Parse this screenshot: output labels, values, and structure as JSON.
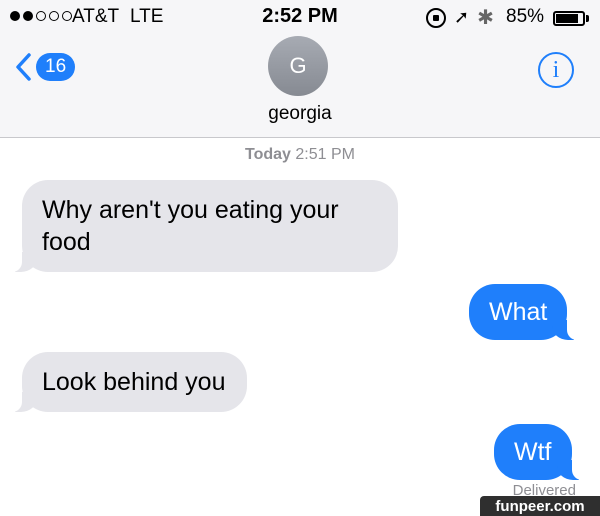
{
  "status_bar": {
    "carrier": "AT&T",
    "network": "LTE",
    "time": "2:52 PM",
    "battery_percent_text": "85%",
    "battery_level": 0.85,
    "signal_bars_filled": 2,
    "signal_bars_total": 5,
    "icons": [
      "orientation-lock-icon",
      "location-arrow-icon",
      "bluetooth-icon",
      "battery-icon"
    ]
  },
  "nav": {
    "back_badge": "16",
    "avatar_initial": "G",
    "contact_name": "georgia",
    "info_label": "i"
  },
  "conversation": {
    "timestamp_day": "Today",
    "timestamp_time": "2:51 PM",
    "messages": [
      {
        "direction": "incoming",
        "text": "Why aren't you eating your food"
      },
      {
        "direction": "outgoing",
        "text": "What"
      },
      {
        "direction": "incoming",
        "text": "Look behind you"
      },
      {
        "direction": "outgoing",
        "text": "Wtf"
      }
    ],
    "delivered_label": "Delivered"
  },
  "watermark": "funpeer.com",
  "colors": {
    "accent": "#1f7ffb",
    "incoming_bubble": "#e5e5ea",
    "header_bg": "#f6f6f8",
    "meta_text": "#8e8e93"
  }
}
